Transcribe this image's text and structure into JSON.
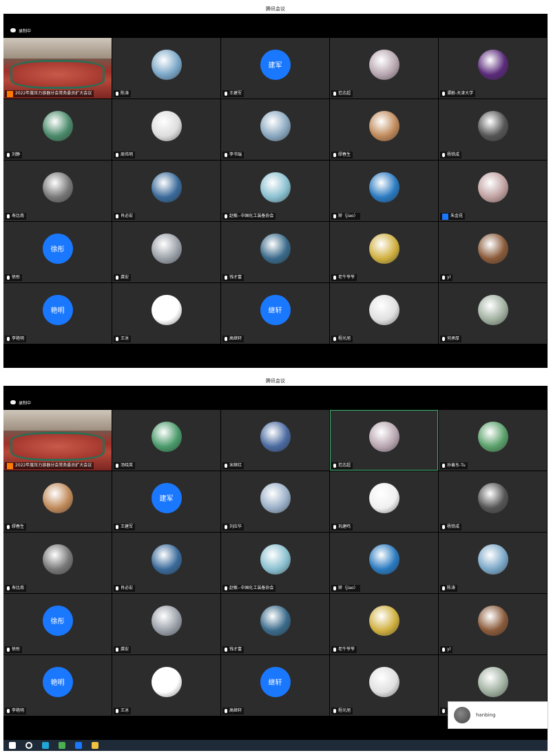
{
  "window1": {
    "title": "腾讯会议",
    "recording": "录制中",
    "tiles": [
      {
        "name": "2022年度压力容器分会常务委员扩大会议",
        "avatar": "conference-room-video",
        "type": "video",
        "badge": "org"
      },
      {
        "name": "陈涛",
        "avatar": "wheat-field-photo",
        "color": "#7aa7c7"
      },
      {
        "name": "王建军",
        "avatar_text": "建军"
      },
      {
        "name": "范志超",
        "avatar": "pink-flower-photo",
        "color": "#b8a6b0"
      },
      {
        "name": "谭蔚-天津大学",
        "avatar": "purple-abstract-photo",
        "color": "#5a2a7a"
      },
      {
        "name": "刘静",
        "avatar": "lake-landscape-photo",
        "color": "#4a8a6a"
      },
      {
        "name": "周伟明",
        "avatar": "ink-painting-photo",
        "color": "#dddddd"
      },
      {
        "name": "李书瑞",
        "avatar": "bridge-sky-photo",
        "color": "#8aa8c0"
      },
      {
        "name": "缪春生",
        "avatar": "sunset-pier-photo",
        "color": "#c08a5a"
      },
      {
        "name": "杨铁成",
        "avatar": "cartoon-man-photo",
        "color": "#555555"
      },
      {
        "name": "寿比南",
        "avatar": "koala-photo",
        "color": "#777777"
      },
      {
        "name": "肖必宏",
        "avatar": "sunset-clouds-photo",
        "color": "#3a6a9a"
      },
      {
        "name": "赵敏--中国化工装备协会",
        "avatar": "wind-turbine-photo",
        "color": "#8ac0d0"
      },
      {
        "name": "矫（jiao）",
        "avatar": "ocean-horizon-photo",
        "color": "#2a7ac0"
      },
      {
        "name": "朱金花",
        "avatar": "blossom-tree-photo",
        "color": "#c0a0a0",
        "badge": "person"
      },
      {
        "name": "徐彤",
        "avatar_text": "徐彤"
      },
      {
        "name": "龚宏",
        "avatar": "sky-bird-photo",
        "color": "#9aa0a8"
      },
      {
        "name": "钱才富",
        "avatar": "canal-city-photo",
        "color": "#3a6a8a"
      },
      {
        "name": "老牛爷爷",
        "avatar": "yellow-flowers-photo",
        "color": "#d0b040"
      },
      {
        "name": "yl",
        "avatar": "campus-building-photo",
        "color": "#8a5a3a"
      },
      {
        "name": "李艳明",
        "avatar_text": "艳明"
      },
      {
        "name": "王冰",
        "avatar": "wang-character-photo",
        "color": "#ffffff"
      },
      {
        "name": "高继轩",
        "avatar_text": "继轩"
      },
      {
        "name": "程光旭",
        "avatar": "portrait-man-photo",
        "color": "#e0e0e0"
      },
      {
        "name": "何承厚",
        "avatar": "tower-trees-photo",
        "color": "#a0b0a0"
      }
    ]
  },
  "window2": {
    "title": "腾讯会议",
    "recording": "录制中",
    "tiles": [
      {
        "name": "2022年度压力容器分会常务委员扩大会议",
        "avatar": "conference-room-video",
        "type": "video",
        "badge": "org"
      },
      {
        "name": "汤晓英",
        "avatar": "green-field-photo",
        "color": "#4a9a6a"
      },
      {
        "name": "宋继红",
        "avatar": "portrait-suit-photo",
        "color": "#4a6aa0"
      },
      {
        "name": "范志超",
        "avatar": "pink-flower-photo",
        "color": "#b8a6b0",
        "active": true
      },
      {
        "name": "孙善东-Tu",
        "avatar": "green-pattern-photo",
        "color": "#5aa06a"
      },
      {
        "name": "缪春生",
        "avatar": "sunset-pier-photo",
        "color": "#c08a5a"
      },
      {
        "name": "王建军",
        "avatar_text": "建军"
      },
      {
        "name": "刘应华",
        "avatar": "flying-bird-photo",
        "color": "#9ab0c8"
      },
      {
        "name": "巩建鸣",
        "avatar": "cartoon-boy-photo",
        "color": "#f0f0f0"
      },
      {
        "name": "杨铁成",
        "avatar": "cartoon-man-photo",
        "color": "#555555"
      },
      {
        "name": "寿比南",
        "avatar": "koala-photo",
        "color": "#777777"
      },
      {
        "name": "肖必宏",
        "avatar": "sunset-clouds-photo",
        "color": "#3a6a9a"
      },
      {
        "name": "赵敏--中国化工装备协会",
        "avatar": "wind-turbine-photo",
        "color": "#8ac0d0"
      },
      {
        "name": "矫（jiao）",
        "avatar": "ocean-horizon-photo",
        "color": "#2a7ac0"
      },
      {
        "name": "陈涛",
        "avatar": "wheat-field-photo",
        "color": "#7aa7c7"
      },
      {
        "name": "徐彤",
        "avatar_text": "徐彤"
      },
      {
        "name": "龚宏",
        "avatar": "sky-bird-photo",
        "color": "#9aa0a8"
      },
      {
        "name": "钱才富",
        "avatar": "canal-city-photo",
        "color": "#3a6a8a"
      },
      {
        "name": "老牛爷爷",
        "avatar": "yellow-flowers-photo",
        "color": "#d0b040"
      },
      {
        "name": "yl",
        "avatar": "campus-building-photo",
        "color": "#8a5a3a"
      },
      {
        "name": "李艳明",
        "avatar_text": "艳明"
      },
      {
        "name": "王冰",
        "avatar": "wang-character-photo",
        "color": "#ffffff"
      },
      {
        "name": "高继轩",
        "avatar_text": "继轩"
      },
      {
        "name": "程光旭",
        "avatar": "portrait-man-photo",
        "color": "#e0e0e0"
      },
      {
        "name": "",
        "avatar": "tower-trees-photo",
        "color": "#a0b0a0"
      }
    ]
  },
  "notification": {
    "name": "hanbing"
  },
  "taskbar": {
    "icons": [
      "windows-start-icon",
      "search-icon",
      "edge-browser-icon",
      "chrome-icon",
      "tencent-meeting-icon",
      "file-explorer-icon"
    ],
    "colors": [
      "#ffffff",
      "#ffffff",
      "#1fa7d6",
      "#4caf50",
      "#1a78ff",
      "#f0c040"
    ]
  }
}
